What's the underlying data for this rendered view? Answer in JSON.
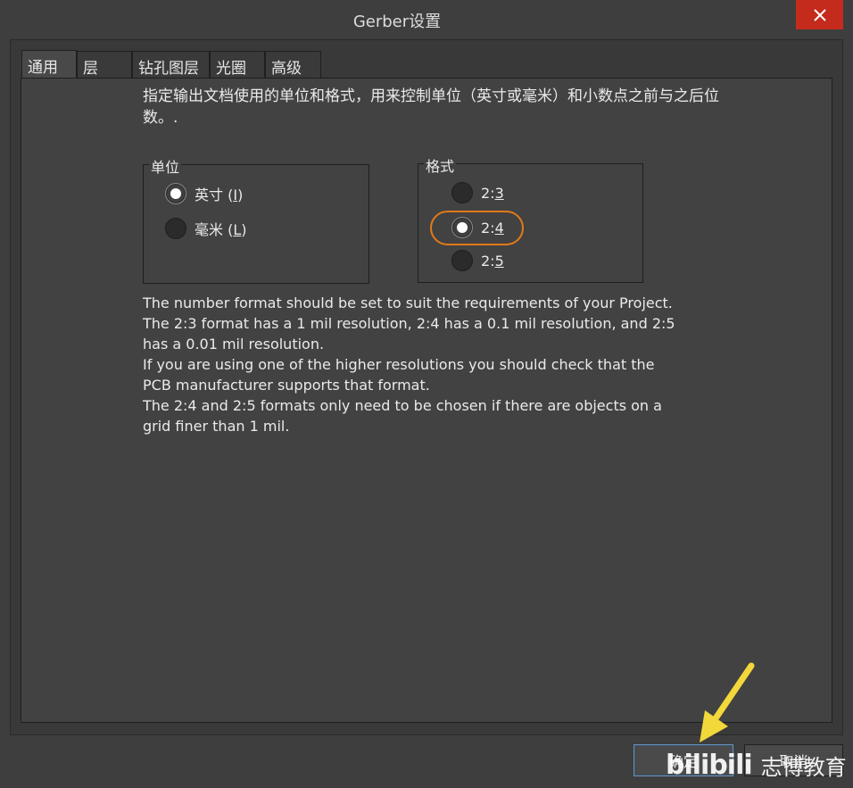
{
  "window": {
    "title": "Gerber设置"
  },
  "tabs": [
    {
      "label": "通用",
      "active": true
    },
    {
      "label": "层",
      "active": false
    },
    {
      "label": "钻孔图层",
      "active": false
    },
    {
      "label": "光圈",
      "active": false
    },
    {
      "label": "高级",
      "active": false
    }
  ],
  "intro_text": "指定输出文档使用的单位和格式，用来控制单位（英寸或毫米）和小数点之前与之后位数。.",
  "units_group": {
    "legend": "单位",
    "options": [
      {
        "label": "英寸",
        "shortcut_prefix": "(",
        "shortcut": "I",
        "shortcut_suffix": ")",
        "checked": true
      },
      {
        "label": "毫米",
        "shortcut_prefix": "(",
        "shortcut": "L",
        "shortcut_suffix": ")",
        "checked": false
      }
    ]
  },
  "format_group": {
    "legend": "格式",
    "options": [
      {
        "prefix": "2:",
        "underlined": "3",
        "checked": false
      },
      {
        "prefix": "2:",
        "underlined": "4",
        "checked": true
      },
      {
        "prefix": "2:",
        "underlined": "5",
        "checked": false
      }
    ]
  },
  "info_lines": [
    "The number format should be set to suit the requirements of your Project.",
    "The 2:3 format has a 1 mil resolution, 2:4 has a 0.1 mil resolution, and 2:5 has a 0.01 mil resolution.",
    "If you are using one of the higher resolutions you should check that the PCB manufacturer supports that format.",
    "The 2:4 and 2:5 formats only need to be chosen if there are objects on a grid finer than 1 mil."
  ],
  "buttons": {
    "ok": "确定",
    "cancel": "取消"
  },
  "watermark": {
    "logo": "bilibili",
    "text": "志博教育"
  },
  "colors": {
    "close_button": "#c42b1c",
    "highlight_ring": "#e07a1a",
    "arrow": "#f2d83a",
    "primary_button_border": "#6b93bd"
  },
  "icons": {
    "close": "close-icon",
    "annotation": "arrow-icon"
  }
}
